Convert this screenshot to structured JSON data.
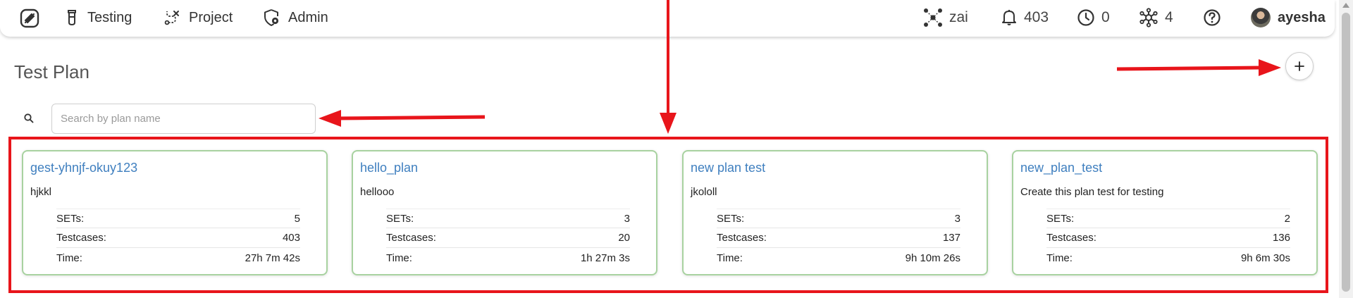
{
  "nav": {
    "items": [
      {
        "label": "Testing",
        "icon": "flask-icon"
      },
      {
        "label": "Project",
        "icon": "route-icon"
      },
      {
        "label": "Admin",
        "icon": "shield-gear-icon"
      }
    ]
  },
  "header_right": {
    "workspace": "zai",
    "notifications_count": "403",
    "history_count": "0",
    "network_count": "4",
    "user_name": "ayesha"
  },
  "page": {
    "title": "Test Plan",
    "search_placeholder": "Search by plan name",
    "search_value": ""
  },
  "stat_labels": {
    "sets": "SETs:",
    "testcases": "Testcases:",
    "time": "Time:"
  },
  "cards": [
    {
      "name": "gest-yhnjf-okuy123",
      "description": "hjkkl",
      "sets": "5",
      "testcases": "403",
      "time": "27h 7m 42s"
    },
    {
      "name": "hello_plan",
      "description": "hellooo",
      "sets": "3",
      "testcases": "20",
      "time": "1h 27m 3s"
    },
    {
      "name": "new plan test",
      "description": "jkololl",
      "sets": "3",
      "testcases": "137",
      "time": "9h 10m 26s"
    },
    {
      "name": "new_plan_test",
      "description": "Create this plan test for testing",
      "sets": "2",
      "testcases": "136",
      "time": "9h 6m 30s"
    }
  ],
  "colors": {
    "accent_link": "#3f7fbf",
    "card_border": "#a8d2a0",
    "annotation_red": "#e8151b"
  }
}
